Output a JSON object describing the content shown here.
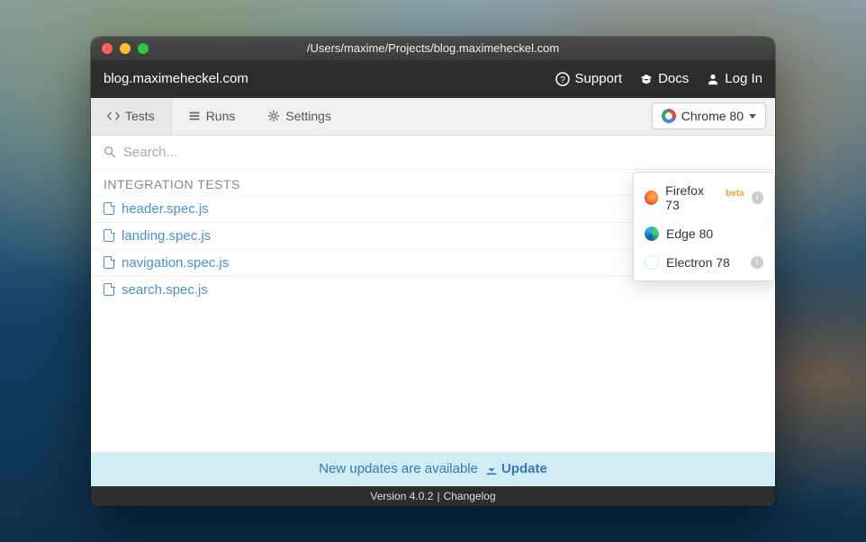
{
  "titlebar": {
    "path": "/Users/maxime/Projects/blog.maximeheckel.com"
  },
  "header": {
    "project": "blog.maximeheckel.com",
    "support": "Support",
    "docs": "Docs",
    "login": "Log In"
  },
  "tabs": {
    "tests": "Tests",
    "runs": "Runs",
    "settings": "Settings"
  },
  "browser_button": {
    "label": "Chrome 80"
  },
  "search": {
    "placeholder": "Search..."
  },
  "section_title": "INTEGRATION TESTS",
  "files": {
    "0": "header.spec.js",
    "1": "landing.spec.js",
    "2": "navigation.spec.js",
    "3": "search.spec.js"
  },
  "dropdown": {
    "firefox": {
      "label": "Firefox 73",
      "badge": "beta"
    },
    "edge": {
      "label": "Edge 80"
    },
    "electron": {
      "label": "Electron 78"
    }
  },
  "update_bar": {
    "message": "New updates are available",
    "action": "Update"
  },
  "footer": {
    "version": "Version 4.0.2",
    "changelog": "Changelog"
  }
}
